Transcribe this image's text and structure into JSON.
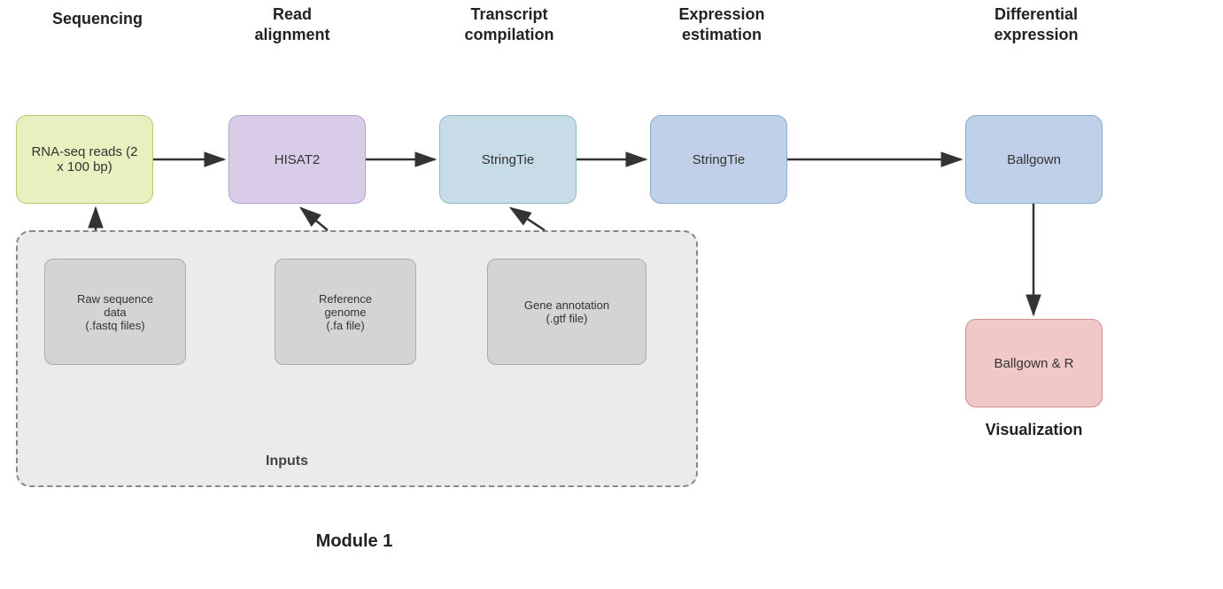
{
  "headers": {
    "sequencing": "Sequencing",
    "read_alignment": "Read\nalignment",
    "transcript_compilation": "Transcript\ncompilation",
    "expression_estimation": "Expression\nestimation",
    "differential_expression": "Differential\nexpression"
  },
  "pipeline": {
    "rnaseq": "RNA-seq reads (2\nx 100 bp)",
    "hisat2": "HISAT2",
    "stringtie1": "StringTie",
    "stringtie2": "StringTie",
    "ballgown": "Ballgown",
    "ballgown_r": "Ballgown & R"
  },
  "inputs": {
    "raw_sequence": "Raw sequence\ndata\n(.fastq files)",
    "reference_genome": "Reference\ngenome\n(.fa file)",
    "gene_annotation": "Gene annotation\n(.gtf file)",
    "label": "Inputs"
  },
  "labels": {
    "module": "Module 1",
    "visualization": "Visualization"
  }
}
